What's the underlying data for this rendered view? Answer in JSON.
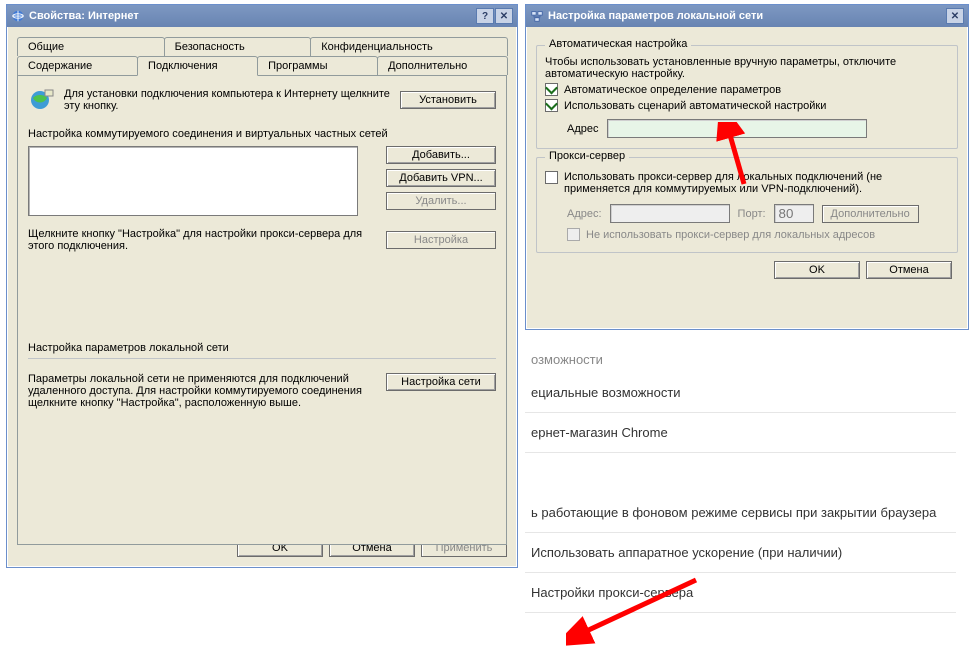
{
  "win1": {
    "title": "Свойства: Интернет",
    "tabs_row1": [
      "Общие",
      "Безопасность",
      "Конфиденциальность"
    ],
    "tabs_row2": [
      "Содержание",
      "Подключения",
      "Программы",
      "Дополнительно"
    ],
    "active_tab": "Подключения",
    "setup_text": "Для установки подключения компьютера к Интернету щелкните эту кнопку.",
    "btn_install": "Установить",
    "group_dial": "Настройка коммутируемого соединения и виртуальных частных сетей",
    "btn_add": "Добавить...",
    "btn_add_vpn": "Добавить VPN...",
    "btn_delete": "Удалить...",
    "btn_settings": "Настройка",
    "click_settings_text": "Щелкните кнопку \"Настройка\" для настройки прокси-сервера для этого подключения.",
    "group_lan": "Настройка параметров локальной сети",
    "lan_text": "Параметры локальной сети не применяются для подключений удаленного доступа. Для настройки коммутируемого соединения щелкните кнопку \"Настройка\", расположенную выше.",
    "btn_lan": "Настройка сети",
    "btn_ok": "OK",
    "btn_cancel": "Отмена",
    "btn_apply": "Применить"
  },
  "win2": {
    "title": "Настройка параметров локальной сети",
    "group_auto": "Автоматическая настройка",
    "auto_hint": "Чтобы использовать установленные вручную параметры, отключите автоматическую настройку.",
    "ck_autodetect": "Автоматическое определение параметров",
    "ck_autoscript": "Использовать сценарий автоматической настройки",
    "address_label": "Адрес",
    "address_value": "",
    "group_proxy": "Прокси-сервер",
    "ck_useproxy": "Использовать прокси-сервер для локальных подключений (не применяется для коммутируемых или VPN-подключений).",
    "addr_label2": "Адрес:",
    "addr_value2": "",
    "port_label": "Порт:",
    "port_value": "80",
    "btn_advanced": "Дополнительно",
    "ck_bypass": "Не использовать прокси-сервер для локальных адресов",
    "btn_ok": "OK",
    "btn_cancel": "Отмена"
  },
  "chrome": {
    "section1": "озможности",
    "item1": "ециальные возможности",
    "item2": "ернет-магазин Chrome",
    "item3": "ь работающие в фоновом режиме сервисы при закрытии браузера",
    "item4": "Использовать аппаратное ускорение (при наличии)",
    "item5": "Настройки прокси-сервера"
  }
}
